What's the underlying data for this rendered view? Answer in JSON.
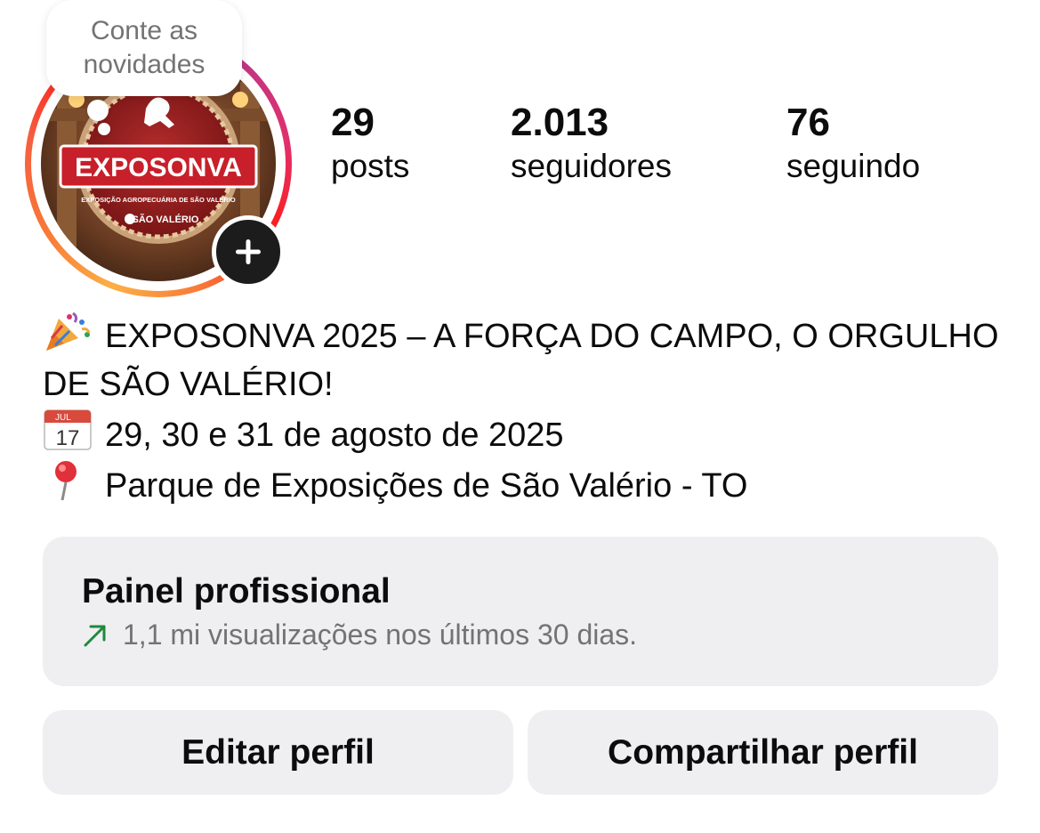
{
  "note": {
    "text": "Conte as novidades"
  },
  "avatar": {
    "logo_text": "EXPOSONVA",
    "logo_subtitle": "EXPOSIÇÃO AGROPECUÁRIA DE SÃO VALÉRIO",
    "logo_brand": "SÃO VALÉRIO"
  },
  "stats": {
    "posts": {
      "value": "29",
      "label": "posts"
    },
    "followers": {
      "value": "2.013",
      "label": "seguidores"
    },
    "following": {
      "value": "76",
      "label": "seguindo"
    }
  },
  "bio": {
    "line1": "EXPOSONVA 2025 – A FORÇA DO CAMPO, O ORGULHO DE SÃO VALÉRIO!",
    "line2": "29, 30 e 31 de agosto de 2025",
    "line3": "Parque de Exposições de São Valério - TO",
    "calendar_month": "JUL",
    "calendar_day": "17"
  },
  "dashboard": {
    "title": "Painel profissional",
    "subtitle": "1,1 mi visualizações nos últimos 30 dias."
  },
  "buttons": {
    "edit": "Editar perfil",
    "share": "Compartilhar perfil"
  },
  "colors": {
    "trend_green": "#1f8a3b",
    "panel_bg": "#efeff2",
    "muted_text": "#737373"
  },
  "icons": {
    "bio_emoji_1": "party-popper-icon",
    "bio_emoji_2": "calendar-icon",
    "bio_emoji_3": "pin-icon",
    "dashboard": "trend-up-arrow-icon",
    "avatar_add": "plus-icon"
  }
}
